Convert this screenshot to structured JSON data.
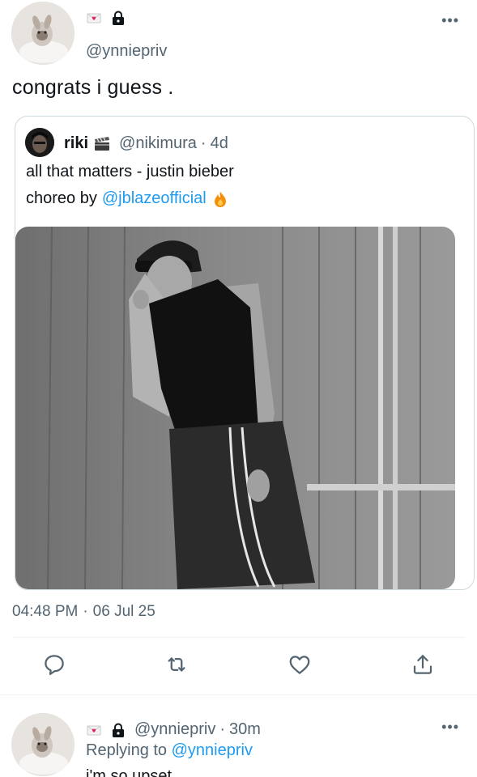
{
  "tweet": {
    "handle": "@ynniepriv",
    "text": "congrats i guess .",
    "timestamp_time": "04:48 PM",
    "timestamp_sep": "·",
    "timestamp_date": "06 Jul 25",
    "icons": [
      "love-letter-icon",
      "lock-icon"
    ]
  },
  "quote": {
    "name": "riki",
    "name_icon": "clapper-board-icon",
    "handle": "@nikimura",
    "sep": "·",
    "age": "4d",
    "line1": "all that matters - justin bieber",
    "line2_prefix": "choreo by",
    "mention": "@jblazeofficial",
    "line2_icon": "fire-icon"
  },
  "actions": [
    "reply-icon",
    "retweet-icon",
    "like-icon",
    "share-icon"
  ],
  "reply": {
    "handle": "@ynniepriv",
    "sep": "·",
    "age": "30m",
    "replying_prefix": "Replying to",
    "replying_mention": "@ynniepriv",
    "text": "i'm so upset"
  },
  "colors": {
    "text": "#0f1419",
    "secondary": "#536471",
    "link": "#1d9bf0",
    "border": "#cfd9de"
  }
}
